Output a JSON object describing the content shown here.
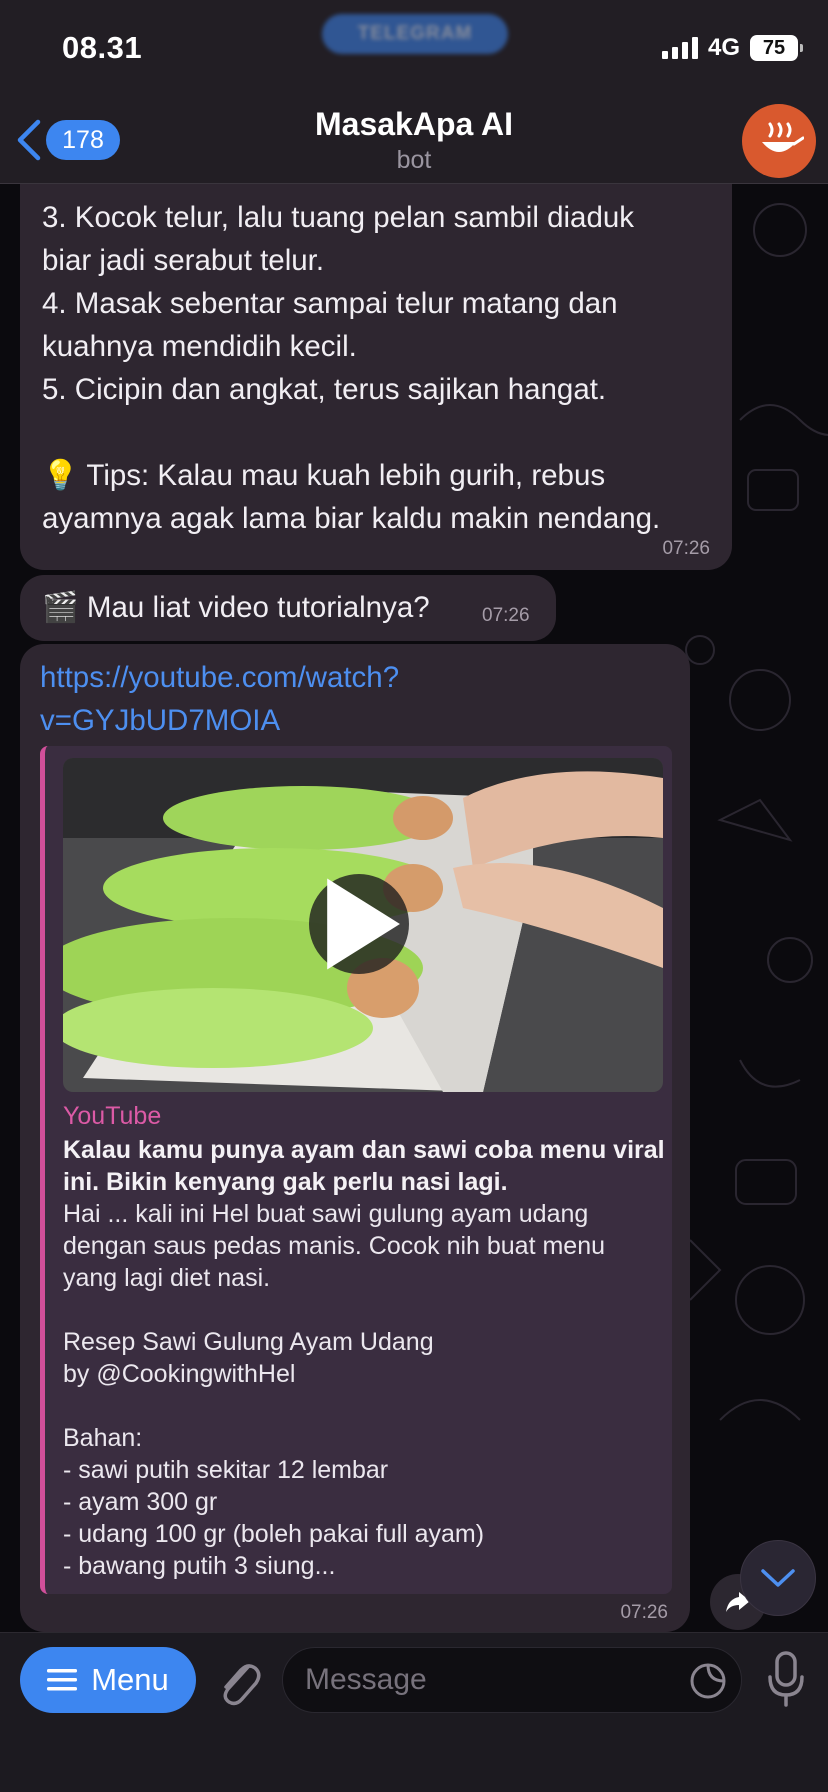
{
  "status_bar": {
    "time": "08.31",
    "pill_label": "TELEGRAM",
    "network": "4G",
    "battery": "75"
  },
  "header": {
    "back_count": "178",
    "title": "MasakApa AI",
    "subtitle": "bot"
  },
  "messages": {
    "recipe_steps": {
      "lines": [
        "3. Kocok telur, lalu tuang pelan sambil diaduk",
        "biar jadi serabut telur.",
        "4. Masak sebentar sampai telur matang dan",
        "kuahnya mendidih kecil.",
        "5. Cicipin dan angkat, terus sajikan hangat.",
        "",
        "💡 Tips: Kalau mau kuah lebih gurih, rebus",
        "ayamnya agak lama biar kaldu makin nendang."
      ],
      "time": "07:26"
    },
    "video_prompt": {
      "text": "🎬 Mau liat video tutorialnya?",
      "time": "07:26"
    },
    "link_message": {
      "link_line1": "https://youtube.com/watch?",
      "link_line2": "v=GYJbUD7MOIA",
      "preview": {
        "site": "YouTube",
        "title": "Kalau kamu punya ayam dan sawi coba menu viral ini. Bikin kenyang gak perlu nasi lagi.",
        "description_lines": [
          "Hai ... kali ini Hel buat sawi gulung ayam udang",
          "dengan saus pedas manis. Cocok nih buat menu",
          "yang lagi diet nasi.",
          "",
          "Resep Sawi Gulung Ayam Udang",
          "by @CookingwithHel",
          "",
          "Bahan:",
          "- sawi putih sekitar 12 lembar",
          "- ayam 300 gr",
          "- udang 100 gr (boleh pakai full ayam)",
          "- bawang putih 3 siung..."
        ]
      },
      "time": "07:26"
    }
  },
  "input_bar": {
    "menu_label": "Menu",
    "placeholder": "Message"
  },
  "colors": {
    "accent": "#3d86f0",
    "link": "#4d8ff0",
    "preview_accent": "#d14f9a",
    "bubble": "#2e2630"
  },
  "icons": [
    "back-chevron-icon",
    "bot-avatar-icon",
    "play-icon",
    "share-icon",
    "chevron-down-icon",
    "menu-icon",
    "paperclip-icon",
    "sticker-icon",
    "microphone-icon"
  ]
}
